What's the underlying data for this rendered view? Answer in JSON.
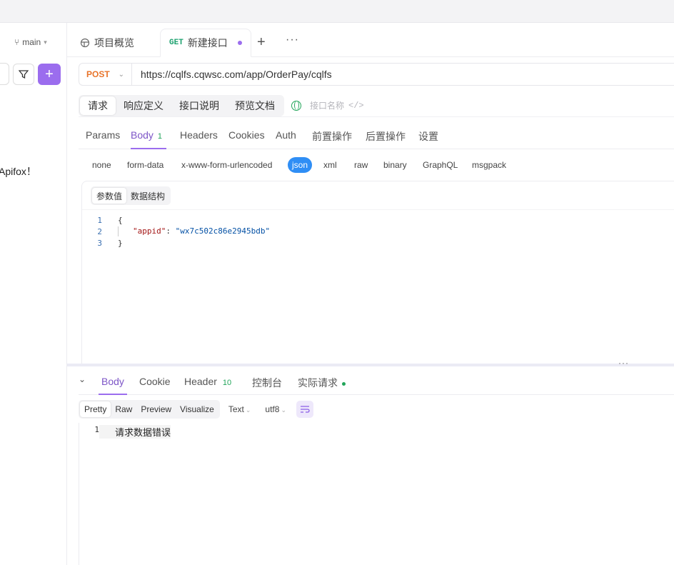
{
  "sidebar": {
    "branch": "main",
    "partial_text": "Apifox！"
  },
  "tabs": {
    "overview": "项目概览",
    "active_method": "GET",
    "active_title": "新建接口",
    "add": "+",
    "more": "···"
  },
  "request": {
    "method": "POST",
    "url": "https://cqlfs.cqwsc.com/app/OrderPay/cqlfs"
  },
  "doc_tabs": [
    "请求",
    "响应定义",
    "接口说明",
    "预览文档"
  ],
  "api_name_placeholder": "接口名称",
  "api_code_icon": "</>",
  "req_tabs": {
    "params": "Params",
    "body": "Body",
    "body_count": "1",
    "headers": "Headers",
    "cookies": "Cookies",
    "auth": "Auth",
    "pre": "前置操作",
    "post": "后置操作",
    "settings": "设置"
  },
  "body_types": [
    "none",
    "form-data",
    "x-www-form-urlencoded",
    "json",
    "xml",
    "raw",
    "binary",
    "GraphQL",
    "msgpack"
  ],
  "editor": {
    "tabs": [
      "参数值",
      "数据结构"
    ],
    "lines": [
      "1",
      "2",
      "3"
    ],
    "open": "{",
    "key": "\"appid\"",
    "colon": ": ",
    "value": "\"wx7c502c86e2945bdb\"",
    "close": "}"
  },
  "response": {
    "collapse": "⌄",
    "tabs": {
      "body": "Body",
      "cookie": "Cookie",
      "header": "Header",
      "header_count": "10",
      "console": "控制台",
      "actual": "实际请求"
    },
    "views": [
      "Pretty",
      "Raw",
      "Preview",
      "Visualize"
    ],
    "format": "Text",
    "encoding": "utf8",
    "line_no": "1",
    "body_text": "请求数据错误"
  },
  "colors": {
    "accent": "#9b6dee",
    "post_method": "#e8742a",
    "get_method": "#1aa06d",
    "json_active": "#2f8ef5",
    "count_green": "#22a55a"
  }
}
